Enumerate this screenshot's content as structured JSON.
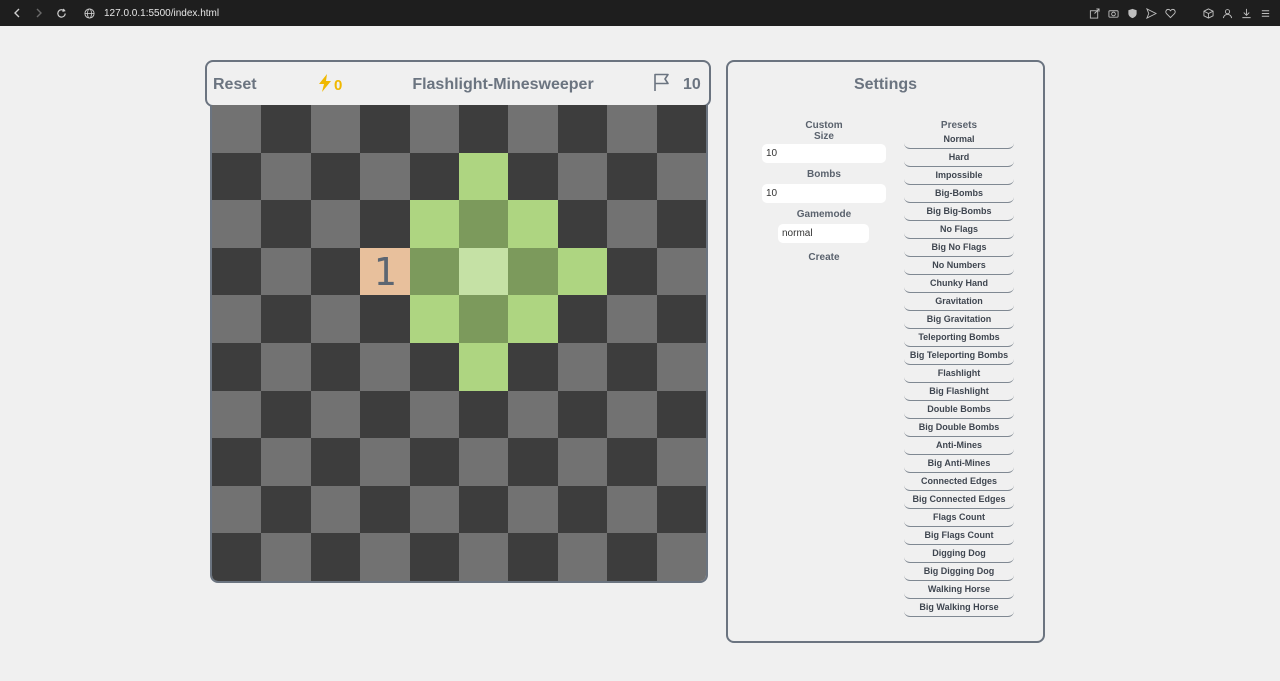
{
  "browser": {
    "url": "127.0.0.1:5500/index.html"
  },
  "game": {
    "reset_label": "Reset",
    "power_count": "0",
    "title": "Flashlight-Minesweeper",
    "flag_count": "10",
    "board": {
      "rows": 10,
      "cols": 10,
      "cells": [
        [
          "l",
          "d",
          "l",
          "d",
          "l",
          "d",
          "l",
          "d",
          "l",
          "d"
        ],
        [
          "d",
          "l",
          "d",
          "l",
          "d",
          "A",
          "d",
          "l",
          "d",
          "l"
        ],
        [
          "l",
          "d",
          "l",
          "d",
          "A",
          "B",
          "A",
          "d",
          "l",
          "d"
        ],
        [
          "d",
          "l",
          "d",
          "R",
          "B",
          "C",
          "B",
          "A",
          "d",
          "l"
        ],
        [
          "l",
          "d",
          "l",
          "d",
          "A",
          "B",
          "A",
          "d",
          "l",
          "d"
        ],
        [
          "d",
          "l",
          "d",
          "l",
          "d",
          "A",
          "d",
          "l",
          "d",
          "l"
        ],
        [
          "l",
          "d",
          "l",
          "d",
          "l",
          "d",
          "l",
          "d",
          "l",
          "d"
        ],
        [
          "d",
          "l",
          "d",
          "l",
          "d",
          "l",
          "d",
          "l",
          "d",
          "l"
        ],
        [
          "l",
          "d",
          "l",
          "d",
          "l",
          "d",
          "l",
          "d",
          "l",
          "d"
        ],
        [
          "d",
          "l",
          "d",
          "l",
          "d",
          "l",
          "d",
          "l",
          "d",
          "l"
        ]
      ],
      "numbers": [
        {
          "row": 3,
          "col": 3,
          "value": "1"
        }
      ]
    }
  },
  "settings": {
    "title": "Settings",
    "custom": {
      "label_line1": "Custom",
      "label_line2": "Size",
      "size_value": "10",
      "bombs_label": "Bombs",
      "bombs_value": "10",
      "gamemode_label": "Gamemode",
      "gamemode_value": "normal",
      "create_label": "Create"
    },
    "presets_label": "Presets",
    "presets": [
      "Normal",
      "Hard",
      "Impossible",
      "Big-Bombs",
      "Big Big-Bombs",
      "No Flags",
      "Big No Flags",
      "No Numbers",
      "Chunky Hand",
      "Gravitation",
      "Big Gravitation",
      "Teleporting Bombs",
      "Big Teleporting Bombs",
      "Flashlight",
      "Big Flashlight",
      "Double Bombs",
      "Big Double Bombs",
      "Anti-Mines",
      "Big Anti-Mines",
      "Connected Edges",
      "Big Connected Edges",
      "Flags Count",
      "Big Flags Count",
      "Digging Dog",
      "Big Digging Dog",
      "Walking Horse",
      "Big Walking Horse"
    ]
  },
  "colors": {
    "accent": "#f0b800",
    "cell_dark": "#3d3d3d",
    "cell_light": "#727272",
    "lit_a": "#aed581",
    "lit_b": "#7c9a5c",
    "lit_c": "#c5e1a5",
    "revealed": "#e8c09c"
  }
}
